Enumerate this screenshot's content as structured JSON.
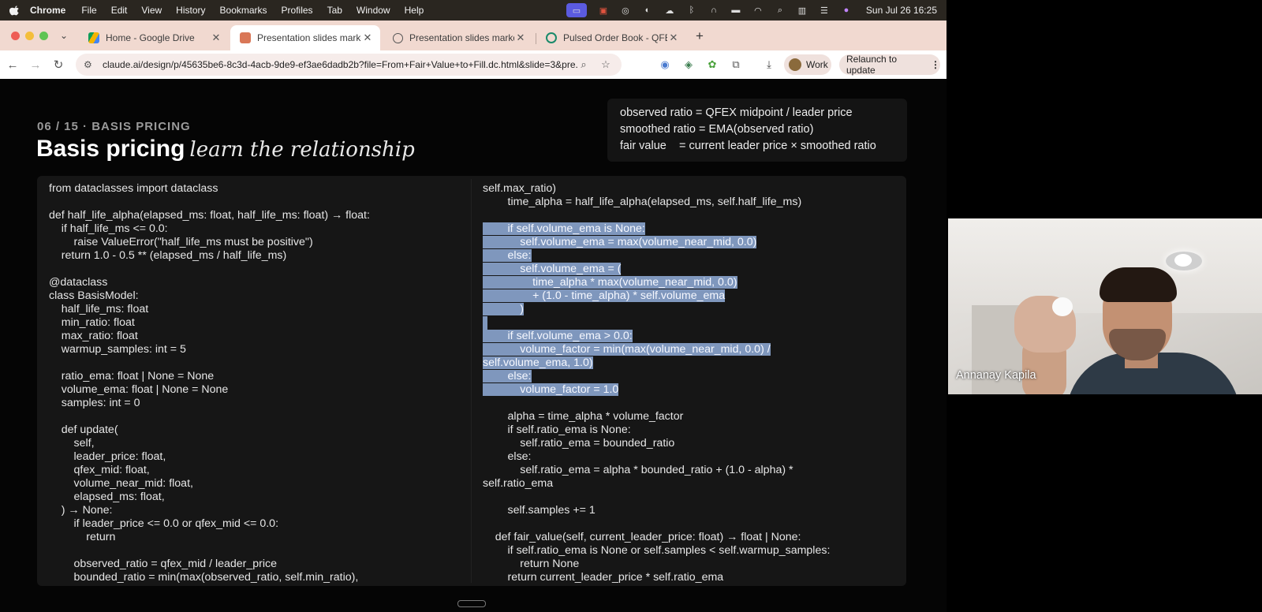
{
  "menubar": {
    "app": "Chrome",
    "items": [
      "File",
      "Edit",
      "View",
      "History",
      "Bookmarks",
      "Profiles",
      "Tab",
      "Window",
      "Help"
    ],
    "clock": "Sun Jul 26  16:25"
  },
  "tabs": [
    {
      "label": "Home - Google Drive",
      "icon": "google-drive-icon",
      "active": false
    },
    {
      "label": "Presentation slides markdow",
      "icon": "claude-icon",
      "active": true
    },
    {
      "label": "Presentation slides markdow",
      "icon": "globe-icon",
      "active": false
    },
    {
      "label": "Pulsed Order Book - QFEX A",
      "icon": "qfex-icon",
      "active": false
    }
  ],
  "toolbar": {
    "url": "claude.ai/design/p/45635be6-8c3d-4acb-9de9-ef3ae6dadb2b?file=From+Fair+Value+to+Fill.dc.html&slide=3&pre...",
    "work_label": "Work",
    "relaunch_label": "Relaunch to update"
  },
  "slide": {
    "eyebrow": "06 / 15 · BASIS PRICING",
    "title": "Basis pricing",
    "subtitle": "learn the relationship",
    "formulas": [
      "observed ratio = QFEX midpoint / leader price",
      "smoothed ratio = EMA(observed ratio)",
      "fair value    = current leader price × smoothed ratio"
    ],
    "code_left": [
      "from dataclasses import dataclass",
      "",
      "def half_life_alpha(elapsed_ms: float, half_life_ms: float) → float:",
      "    if half_life_ms <= 0.0:",
      "        raise ValueError(\"half_life_ms must be positive\")",
      "    return 1.0 - 0.5 ** (elapsed_ms / half_life_ms)",
      "",
      "@dataclass",
      "class BasisModel:",
      "    half_life_ms: float",
      "    min_ratio: float",
      "    max_ratio: float",
      "    warmup_samples: int = 5",
      "",
      "    ratio_ema: float | None = None",
      "    volume_ema: float | None = None",
      "    samples: int = 0",
      "",
      "    def update(",
      "        self,",
      "        leader_price: float,",
      "        qfex_mid: float,",
      "        volume_near_mid: float,",
      "        elapsed_ms: float,",
      "    ) → None:",
      "        if leader_price <= 0.0 or qfex_mid <= 0.0:",
      "            return",
      "",
      "        observed_ratio = qfex_mid / leader_price",
      "        bounded_ratio = min(max(observed_ratio, self.min_ratio),"
    ],
    "code_right": [
      "self.max_ratio)",
      "        time_alpha = half_life_alpha(elapsed_ms, self.half_life_ms)",
      "",
      "        if self.volume_ema is None:",
      "            self.volume_ema = max(volume_near_mid, 0.0)",
      "        else:",
      "            self.volume_ema = (",
      "                time_alpha * max(volume_near_mid, 0.0)",
      "                + (1.0 - time_alpha) * self.volume_ema",
      "            )",
      "",
      "        if self.volume_ema > 0.0:",
      "            volume_factor = min(max(volume_near_mid, 0.0) /",
      "self.volume_ema, 1.0)",
      "        else:",
      "            volume_factor = 1.0",
      "",
      "        alpha = time_alpha * volume_factor",
      "        if self.ratio_ema is None:",
      "            self.ratio_ema = bounded_ratio",
      "        else:",
      "            self.ratio_ema = alpha * bounded_ratio + (1.0 - alpha) *",
      "self.ratio_ema",
      "",
      "        self.samples += 1",
      "",
      "    def fair_value(self, current_leader_price: float) → float | None:",
      "        if self.ratio_ema is None or self.samples < self.warmup_samples:",
      "            return None",
      "        return current_leader_price * self.ratio_ema"
    ],
    "highlight_right_lines": [
      3,
      15
    ]
  },
  "video": {
    "participant_name": "Annanay Kapila"
  },
  "colors": {
    "selection": "#7f97bd",
    "tabstrip": "#f1d9d0",
    "menubar": "#2a2620"
  }
}
